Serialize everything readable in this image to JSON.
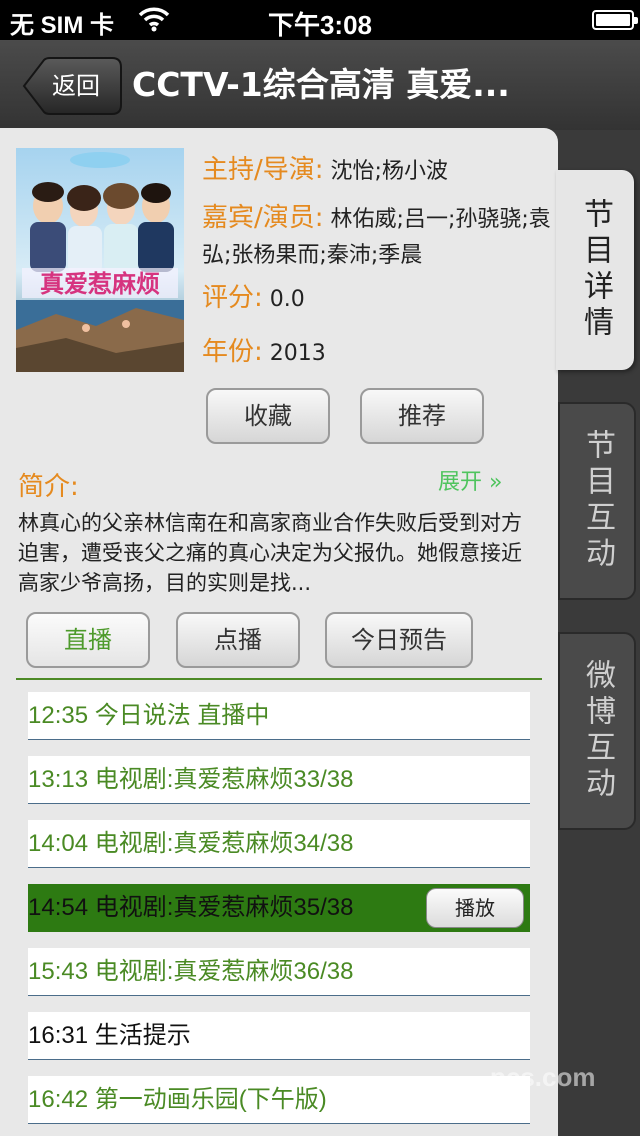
{
  "status_bar": {
    "carrier": "无 SIM 卡",
    "time": "下午3:08"
  },
  "nav": {
    "back_label": "返回",
    "title": "CCTV-1综合高清 真爱..."
  },
  "side_tabs": [
    {
      "label": "节目详情"
    },
    {
      "label": "节目互动"
    },
    {
      "label": "微博互动"
    }
  ],
  "details": {
    "poster_title": "真爱惹麻烦",
    "director_label": "主持/导演:",
    "director_value": "沈怡;杨小波",
    "cast_label": "嘉宾/演员:",
    "cast_value": "林佑威;吕一;孙骁骁;袁弘;张杨果而;秦沛;季晨",
    "rating_label": "评分:",
    "rating_value": "0.0",
    "year_label": "年份:",
    "year_value": "2013",
    "favorite_label": "收藏",
    "recommend_label": "推荐"
  },
  "intro": {
    "label": "简介:",
    "expand_label": "展开 »",
    "text": "林真心的父亲林信南在和高家商业合作失败后受到对方迫害，遭受丧父之痛的真心决定为父报仇。她假意接近高家少爷高扬，目的实则是找..."
  },
  "schedule_tabs": {
    "live": "直播",
    "vod": "点播",
    "preview": "今日预告"
  },
  "programs": [
    {
      "text": "12:35 今日说法 直播中"
    },
    {
      "text": "13:13 电视剧:真爱惹麻烦33/38"
    },
    {
      "text": "14:04 电视剧:真爱惹麻烦34/38"
    },
    {
      "text": "14:54 电视剧:真爱惹麻烦35/38"
    },
    {
      "text": "15:43 电视剧:真爱惹麻烦36/38"
    },
    {
      "text": "16:31 生活提示"
    },
    {
      "text": "16:42 第一动画乐园(下午版)"
    }
  ],
  "play_label": "播放",
  "watermark": "pcs.com",
  "colors": {
    "accent_orange": "#e58a1f",
    "accent_green": "#4a8a24",
    "selected_row": "#2d7a12"
  }
}
